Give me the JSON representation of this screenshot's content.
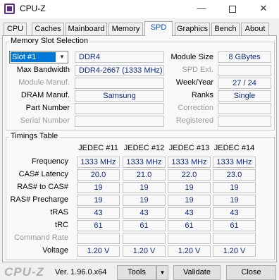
{
  "window": {
    "title": "CPU-Z",
    "minimize_glyph": "—",
    "close_glyph": "✕"
  },
  "tabs": [
    "CPU",
    "Caches",
    "Mainboard",
    "Memory",
    "SPD",
    "Graphics",
    "Bench",
    "About"
  ],
  "active_tab": "SPD",
  "slot_section": {
    "title": "Memory Slot Selection",
    "slot_value": "Slot #1",
    "memory_type": "DDR4",
    "max_bandwidth_label": "Max Bandwidth",
    "max_bandwidth_value": "DDR4-2667 (1333 MHz)",
    "module_manuf_label": "Module Manuf.",
    "module_manuf_value": "",
    "dram_manuf_label": "DRAM Manuf.",
    "dram_manuf_value": "Samsung",
    "part_number_label": "Part Number",
    "part_number_value": "",
    "serial_number_label": "Serial Number",
    "serial_number_value": "",
    "module_size_label": "Module Size",
    "module_size_value": "8 GBytes",
    "spd_ext_label": "SPD Ext.",
    "spd_ext_value": "",
    "week_year_label": "Week/Year",
    "week_year_value": "27 / 24",
    "ranks_label": "Ranks",
    "ranks_value": "Single",
    "correction_label": "Correction",
    "correction_value": "",
    "registered_label": "Registered",
    "registered_value": ""
  },
  "timings": {
    "title": "Timings Table",
    "columns": [
      "JEDEC #11",
      "JEDEC #12",
      "JEDEC #13",
      "JEDEC #14"
    ],
    "rows": [
      {
        "label": "Frequency",
        "values": [
          "1333 MHz",
          "1333 MHz",
          "1333 MHz",
          "1333 MHz"
        ]
      },
      {
        "label": "CAS# Latency",
        "values": [
          "20.0",
          "21.0",
          "22.0",
          "23.0"
        ]
      },
      {
        "label": "RAS# to CAS#",
        "values": [
          "19",
          "19",
          "19",
          "19"
        ]
      },
      {
        "label": "RAS# Precharge",
        "values": [
          "19",
          "19",
          "19",
          "19"
        ]
      },
      {
        "label": "tRAS",
        "values": [
          "43",
          "43",
          "43",
          "43"
        ]
      },
      {
        "label": "tRC",
        "values": [
          "61",
          "61",
          "61",
          "61"
        ]
      },
      {
        "label": "Command Rate",
        "values": [
          "",
          "",
          "",
          ""
        ]
      },
      {
        "label": "Voltage",
        "values": [
          "1.20 V",
          "1.20 V",
          "1.20 V",
          "1.20 V"
        ]
      }
    ]
  },
  "footer": {
    "brand": "CPU-Z",
    "version": "Ver. 1.96.0.x64",
    "tools_label": "Tools",
    "validate_label": "Validate",
    "close_label": "Close"
  }
}
